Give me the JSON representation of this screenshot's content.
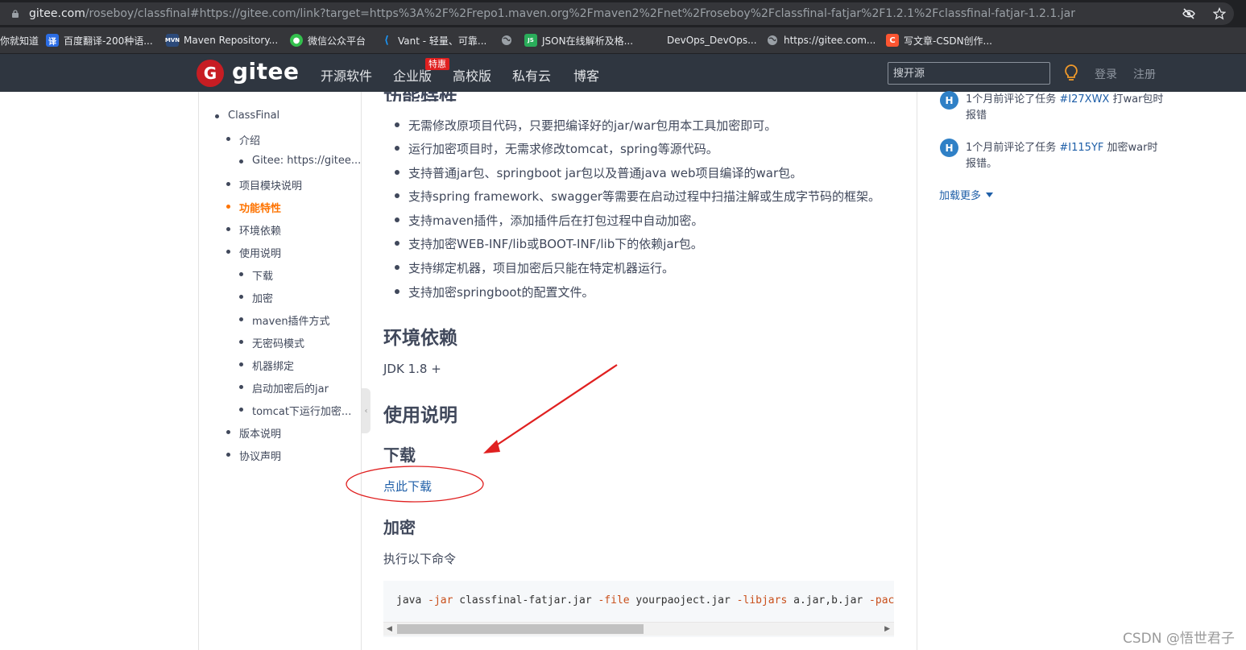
{
  "browser": {
    "url_domain": "gitee.com",
    "url_rest": "/roseboy/classfinal#https://gitee.com/link?target=https%3A%2F%2Frepo1.maven.org%2Fmaven2%2Fnet%2Froseboy%2Fclassfinal-fatjar%2F1.2.1%2Fclassfinal-fatjar-1.2.1.jar",
    "icons": [
      "lock-icon",
      "eye-slash-icon",
      "star-icon"
    ]
  },
  "bookmarks": [
    {
      "label": "你就知道",
      "icon": "text"
    },
    {
      "label": "百度翻译-200种语...",
      "icon": "translate",
      "color": "#2b6de5"
    },
    {
      "label": "Maven Repository...",
      "icon": "maven",
      "color": "#2c4a7a"
    },
    {
      "label": "微信公众平台",
      "icon": "wechat",
      "color": "#33c04d"
    },
    {
      "label": "Vant - 轻量、可靠...",
      "icon": "vant",
      "color": "#1b95f5"
    },
    {
      "label": "JSON在线解析及格...",
      "icon": "json",
      "color": "#2aad5a"
    },
    {
      "label": "DevOps_DevOps...",
      "icon": "blank"
    },
    {
      "label": "https://gitee.com...",
      "icon": "globe"
    },
    {
      "label": "写文章-CSDN创作...",
      "icon": "csdn",
      "color": "#fc5531"
    }
  ],
  "header": {
    "logo_text": "gitee",
    "logo_letter": "G",
    "nav": [
      "开源软件",
      "企业版",
      "高校版",
      "私有云",
      "博客"
    ],
    "badge": "特惠",
    "search_placeholder": "搜开源",
    "login": "登录",
    "register": "注册",
    "accent": "#c71d23"
  },
  "toc": {
    "items": [
      {
        "label": "ClassFinal",
        "level": 1
      },
      {
        "label": "介绍",
        "level": 2
      },
      {
        "label": "Gitee: https://gitee...",
        "level": 3
      },
      {
        "label": "项目模块说明",
        "level": 2
      },
      {
        "label": "功能特性",
        "level": 2,
        "active": true
      },
      {
        "label": "环境依赖",
        "level": 2
      },
      {
        "label": "使用说明",
        "level": 2
      },
      {
        "label": "下载",
        "level": 3
      },
      {
        "label": "加密",
        "level": 3
      },
      {
        "label": "maven插件方式",
        "level": 3
      },
      {
        "label": "无密码模式",
        "level": 3
      },
      {
        "label": "机器绑定",
        "level": 3
      },
      {
        "label": "启动加密后的jar",
        "level": 3
      },
      {
        "label": "tomcat下运行加密...",
        "level": 3
      },
      {
        "label": "版本说明",
        "level": 2
      },
      {
        "label": "协议声明",
        "level": 2
      }
    ],
    "active_color": "#fe7300"
  },
  "article": {
    "cut_heading": "功能特性",
    "features": [
      "无需修改原项目代码，只要把编译好的jar/war包用本工具加密即可。",
      "运行加密项目时，无需求修改tomcat，spring等源代码。",
      "支持普通jar包、springboot jar包以及普通java web项目编译的war包。",
      "支持spring framework、swagger等需要在启动过程中扫描注解或生成字节码的框架。",
      "支持maven插件，添加插件后在打包过程中自动加密。",
      "支持加密WEB-INF/lib或BOOT-INF/lib下的依赖jar包。",
      "支持绑定机器，项目加密后只能在特定机器运行。",
      "支持加密springboot的配置文件。"
    ],
    "env_heading": "环境依赖",
    "env_text": "JDK 1.8 +",
    "usage_heading": "使用说明",
    "download_heading": "下载",
    "download_link": "点此下载",
    "encrypt_heading": "加密",
    "encrypt_text": "执行以下命令",
    "code": {
      "p1": "java ",
      "k1": "-jar",
      "p2": " classfinal-fatjar.jar ",
      "k2": "-file",
      "p3": " yourpaoject.jar ",
      "k3": "-libjars",
      "p4": " a.jar,b.jar ",
      "k4": "-packages"
    }
  },
  "activity": [
    {
      "avatar": "H",
      "prefix": "1个月前评论了任务 ",
      "issue": "#I27XWX",
      "suffix": " 打war包时报错"
    },
    {
      "avatar": "H",
      "prefix": "1个月前评论了任务 ",
      "issue": "#I115YF",
      "suffix": " 加密war时报错。"
    }
  ],
  "load_more": "加载更多",
  "annotation": {
    "color": "#e02020"
  },
  "watermark": "CSDN @悟世君子"
}
